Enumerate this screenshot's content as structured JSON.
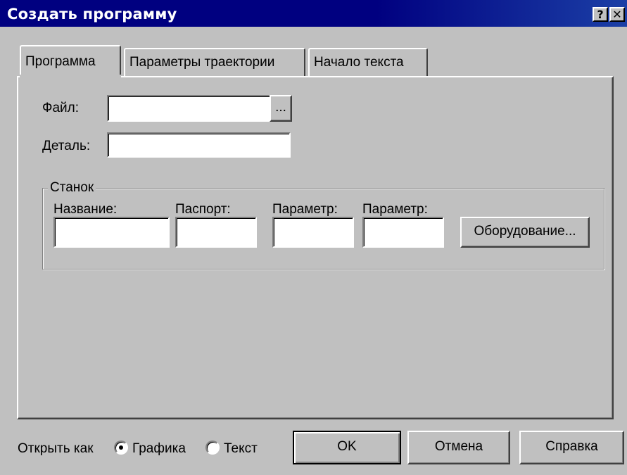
{
  "window": {
    "title": "Создать программу",
    "help_glyph": "?",
    "close_glyph": "✕"
  },
  "tabs": [
    {
      "label": "Программа",
      "active": true
    },
    {
      "label": "Параметры траектории",
      "active": false
    },
    {
      "label": "Начало текста",
      "active": false
    }
  ],
  "program": {
    "file_label": "Файл:",
    "file_value": "",
    "browse_label": "...",
    "detail_label": "Деталь:",
    "detail_value": ""
  },
  "machine": {
    "group_label": "Станок",
    "name_label": "Название:",
    "name_value": "",
    "passport_label": "Паспорт:",
    "passport_value": "",
    "param1_label": "Параметр:",
    "param1_value": "",
    "param2_label": "Параметр:",
    "param2_value": "",
    "equipment_button": "Оборудование..."
  },
  "footer": {
    "open_as_label": "Открыть как",
    "radio_graphics": "Графика",
    "radio_text": "Текст",
    "selected": "Графика",
    "ok": "OK",
    "cancel": "Отмена",
    "help": "Справка"
  }
}
